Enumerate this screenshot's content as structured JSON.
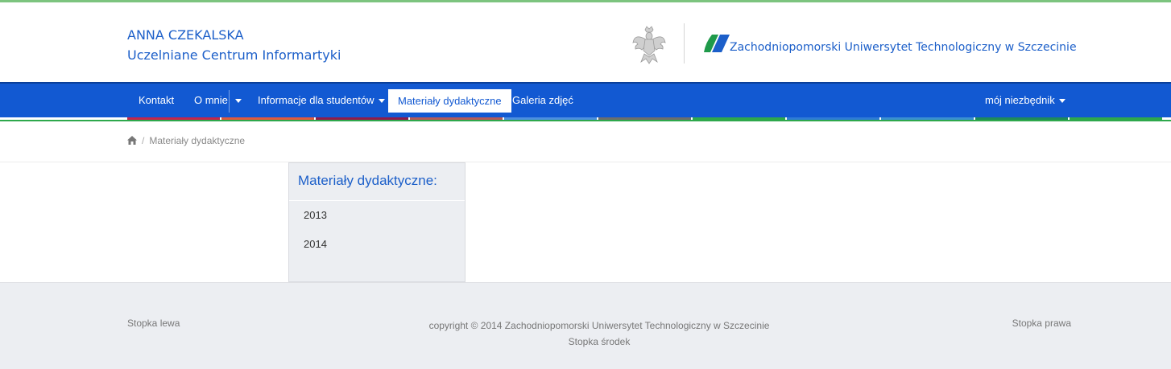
{
  "header": {
    "author_name": "ANNA CZEKALSKA",
    "unit_name": "Uczelniane Centrum Informartyki",
    "university_name": "Zachodniopomorski Uniwersytet Technologiczny w Szczecinie",
    "emblem_icon": "polish-eagle-icon",
    "logo_icon": "zut-logo-icon"
  },
  "nav": {
    "items": [
      {
        "label": "Kontakt"
      },
      {
        "label": "O mnie"
      },
      {
        "label": "Informacje dla studentów"
      },
      {
        "label": "Materiały dydaktyczne",
        "active": true
      },
      {
        "label": "Galeria zdjęć"
      }
    ],
    "right_menu": "mój niezbędnik",
    "bg_color": "#1259d2",
    "stripe_colors": [
      "#c4264b",
      "#e0593f",
      "#8e1c4c",
      "#b55a5a",
      "#4c8ee0",
      "#6d6d6d",
      "#2ea84c",
      "#2e7bd6",
      "#3a8fd0",
      "#1e8a5a",
      "#2ea84c"
    ]
  },
  "breadcrumb": {
    "home_icon": "home-icon",
    "current": "Materiały dydaktyczne"
  },
  "sidebar": {
    "title": "Materiały dydaktyczne:",
    "items": [
      {
        "label": "2013"
      },
      {
        "label": "2014"
      }
    ]
  },
  "footer": {
    "left": "Stopka lewa",
    "center_line1": "copyright © 2014 Zachodniopomorski Uniwersytet Technologiczny w Szczecinie",
    "center_line2": "Stopka środek",
    "right": "Stopka prawa"
  }
}
